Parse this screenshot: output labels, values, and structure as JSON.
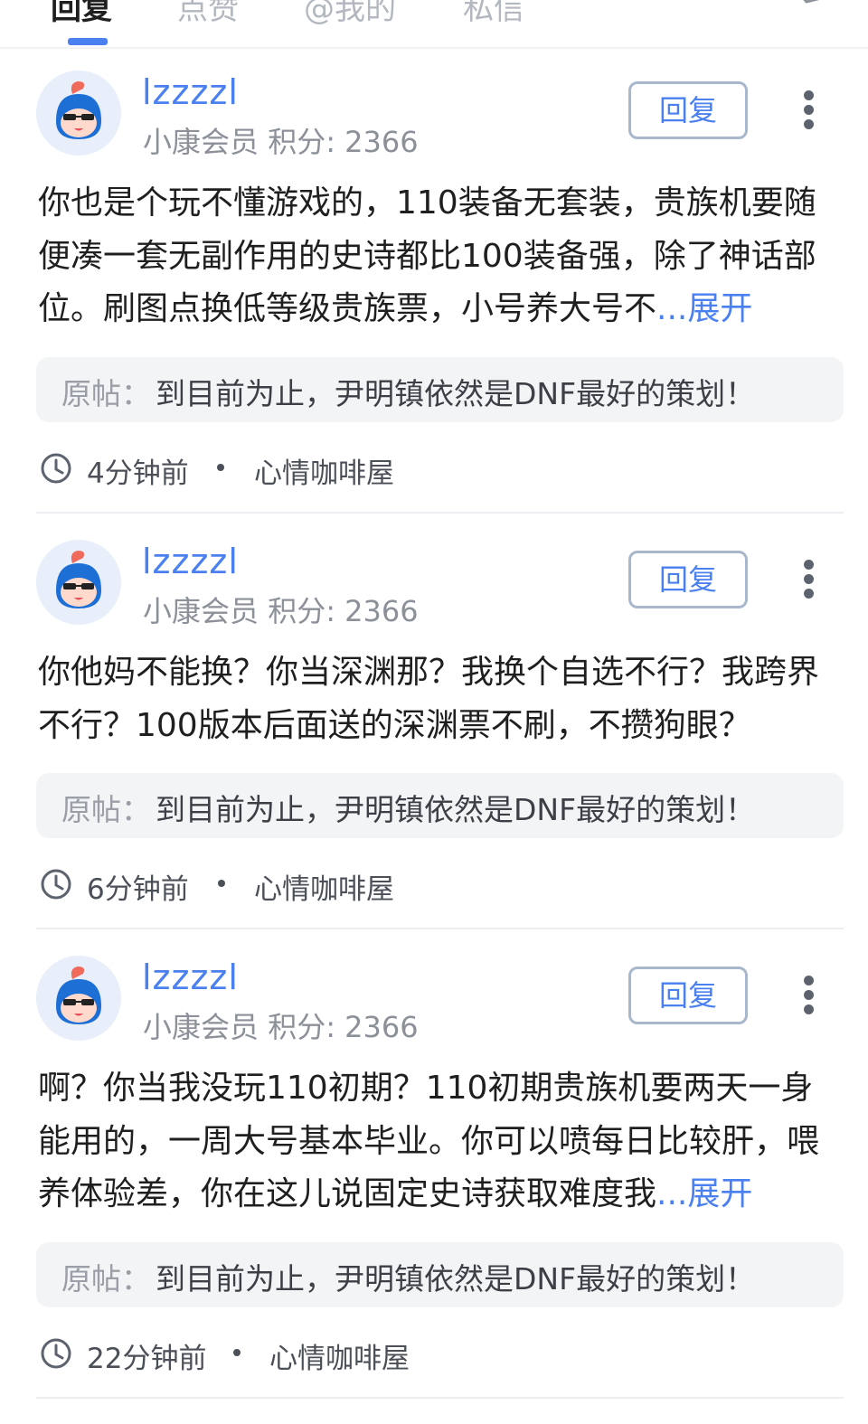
{
  "tabs": [
    {
      "label": "回复"
    },
    {
      "label": "点赞"
    },
    {
      "label": "@我的"
    },
    {
      "label": "私信"
    }
  ],
  "comments": [
    {
      "username": "lzzzzl",
      "member": "小康会员",
      "points": "积分: 2366",
      "reply_label": "回复",
      "body": "你也是个玩不懂游戏的，110装备无套装，贵族机要随便凑一套无副作用的史诗都比100装备强，除了神话部位。刷图点换低等级贵族票，小号养大号不",
      "ellipsis": "...",
      "expand_label": "展开",
      "origin_label": "原帖：",
      "origin_text": "到目前为止，尹明镇依然是DNF最好的策划！",
      "time": "4分钟前",
      "channel": "心情咖啡屋"
    },
    {
      "username": "lzzzzl",
      "member": "小康会员",
      "points": "积分: 2366",
      "reply_label": "回复",
      "body": "你他妈不能换？你当深渊那？我换个自选不行？我跨界不行？100版本后面送的深渊票不刷，不攒狗眼？",
      "origin_label": "原帖：",
      "origin_text": "到目前为止，尹明镇依然是DNF最好的策划！",
      "time": "6分钟前",
      "channel": "心情咖啡屋"
    },
    {
      "username": "lzzzzl",
      "member": "小康会员",
      "points": "积分: 2366",
      "reply_label": "回复",
      "body": "啊？你当我没玩110初期？110初期贵族机要两天一身能用的，一周大号基本毕业。你可以喷每日比较肝，喂养体验差，你在这儿说固定史诗获取难度我",
      "ellipsis": "...",
      "expand_label": "展开",
      "origin_label": "原帖：",
      "origin_text": "到目前为止，尹明镇依然是DNF最好的策划！",
      "time": "22分钟前",
      "channel": "心情咖啡屋"
    }
  ],
  "colors": {
    "accent": "#4a80f0",
    "meta": "#8c9099",
    "origin_bg": "#f3f4f6"
  },
  "icons": [
    "edit-icon",
    "clock-icon",
    "more-icon",
    "avatar-mascot"
  ]
}
